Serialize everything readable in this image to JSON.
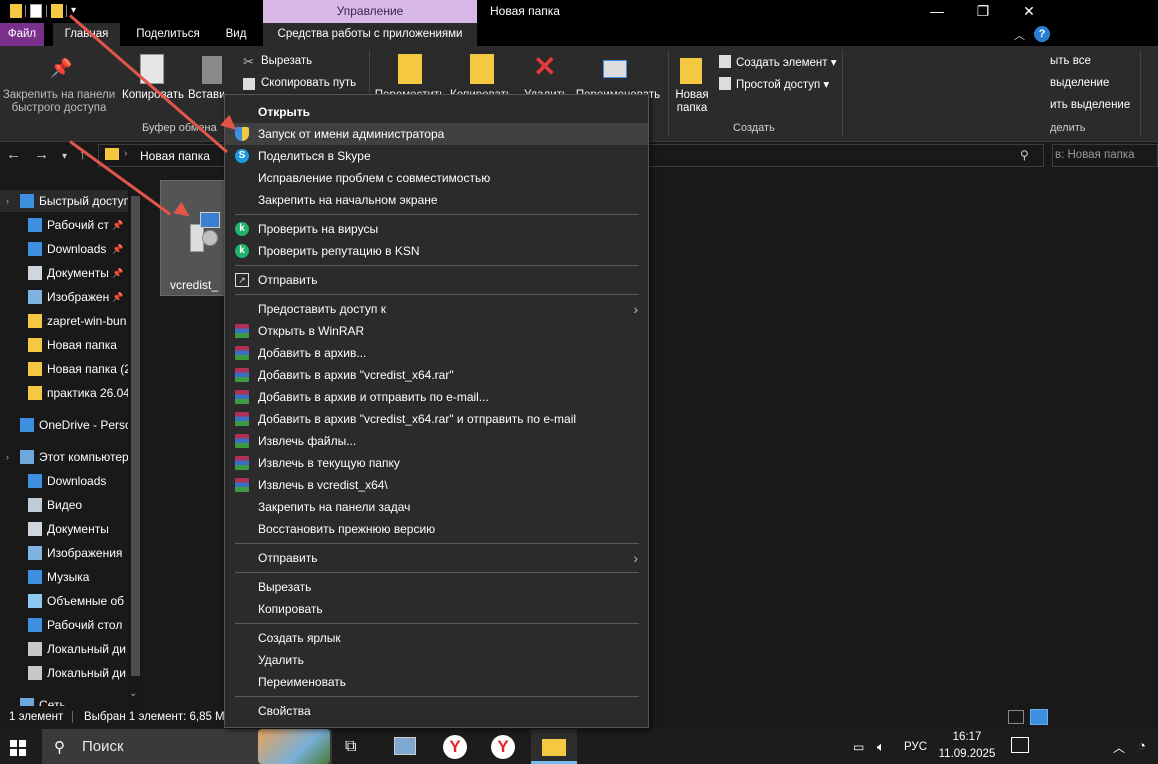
{
  "titlebar": {
    "manage_tab": "Управление",
    "window_title": "Новая папка",
    "minimize": "—",
    "maximize": "❐",
    "close": "✕"
  },
  "ribbon_tabs": {
    "file": "Файл",
    "home": "Главная",
    "share": "Поделиться",
    "view": "Вид",
    "app_tools": "Средства работы с приложениями"
  },
  "ribbon": {
    "pin_label": "Закрепить на панели быстрого доступа",
    "copy": "Копировать",
    "paste": "Вставить",
    "cut": "Вырезать",
    "copy_path": "Скопировать путь",
    "clipboard_group": "Буфер обмена",
    "move": "Переместить",
    "copy_to": "Копировать",
    "delete": "Удалить",
    "rename": "Переименовать",
    "new_folder_line1": "Новая",
    "new_folder_line2": "папка",
    "new_item": "Создать элемент ▾",
    "easy_access": "Простой доступ ▾",
    "create_group": "Создать",
    "select_all": "ыть все",
    "select_none": "выделение",
    "invert_selection": "ить выделение",
    "select_group": "делить"
  },
  "navbar": {
    "path": "Новая папка",
    "search_placeholder": "в: Новая папка"
  },
  "nav_pane": [
    {
      "label": "Быстрый доступ",
      "icon": "star-icon"
    },
    {
      "label": "Рабочий ст",
      "icon": "desktop-icon",
      "pinned": true
    },
    {
      "label": "Downloads",
      "icon": "download-icon",
      "pinned": true
    },
    {
      "label": "Документы",
      "icon": "documents-icon",
      "pinned": true
    },
    {
      "label": "Изображен",
      "icon": "pictures-icon",
      "pinned": true
    },
    {
      "label": "zapret-win-bun",
      "icon": "folder-icon"
    },
    {
      "label": "Новая папка",
      "icon": "folder-icon"
    },
    {
      "label": "Новая папка (2",
      "icon": "folder-icon"
    },
    {
      "label": "практика 26.04",
      "icon": "folder-icon"
    },
    {
      "label": "OneDrive - Perso",
      "icon": "onedrive-icon"
    },
    {
      "label": "Этот компьютер",
      "icon": "computer-icon"
    },
    {
      "label": "Downloads",
      "icon": "download-icon"
    },
    {
      "label": "Видео",
      "icon": "video-icon"
    },
    {
      "label": "Документы",
      "icon": "documents-icon"
    },
    {
      "label": "Изображения",
      "icon": "pictures-icon"
    },
    {
      "label": "Музыка",
      "icon": "music-icon"
    },
    {
      "label": "Объемные об",
      "icon": "3d-objects-icon"
    },
    {
      "label": "Рабочий стол",
      "icon": "desktop-icon"
    },
    {
      "label": "Локальный ди",
      "icon": "drive-icon"
    },
    {
      "label": "Локальный ди",
      "icon": "drive-icon"
    },
    {
      "label": "Сеть",
      "icon": "network-icon"
    }
  ],
  "file": {
    "name": "vcredist_"
  },
  "context_menu": [
    {
      "label": "Открыть",
      "bold": true,
      "icon": ""
    },
    {
      "label": "Запуск от имени администратора",
      "icon": "shield-icon",
      "highlighted": true
    },
    {
      "label": "Поделиться в Skype",
      "icon": "skype-icon"
    },
    {
      "label": "Исправление проблем с совместимостью",
      "icon": ""
    },
    {
      "label": "Закрепить на начальном экране",
      "icon": ""
    },
    {
      "sep": true
    },
    {
      "label": "Проверить на вирусы",
      "icon": "kaspersky-icon"
    },
    {
      "label": "Проверить репутацию в KSN",
      "icon": "kaspersky-icon"
    },
    {
      "sep": true
    },
    {
      "label": "Отправить",
      "icon": "share-icon"
    },
    {
      "sep": true
    },
    {
      "label": "Предоставить доступ к",
      "icon": "",
      "submenu": true
    },
    {
      "label": "Открыть в WinRAR",
      "icon": "winrar-icon"
    },
    {
      "label": "Добавить в архив...",
      "icon": "winrar-icon"
    },
    {
      "label": "Добавить в архив \"vcredist_x64.rar\"",
      "icon": "winrar-icon"
    },
    {
      "label": "Добавить в архив и отправить по e-mail...",
      "icon": "winrar-icon"
    },
    {
      "label": "Добавить в архив \"vcredist_x64.rar\" и отправить по e-mail",
      "icon": "winrar-icon"
    },
    {
      "label": "Извлечь файлы...",
      "icon": "winrar-icon"
    },
    {
      "label": "Извлечь в текущую папку",
      "icon": "winrar-icon"
    },
    {
      "label": "Извлечь в vcredist_x64\\",
      "icon": "winrar-icon"
    },
    {
      "label": "Закрепить на панели задач",
      "icon": ""
    },
    {
      "label": "Восстановить прежнюю версию",
      "icon": ""
    },
    {
      "sep": true
    },
    {
      "label": "Отправить",
      "icon": "",
      "submenu": true
    },
    {
      "sep": true
    },
    {
      "label": "Вырезать",
      "icon": ""
    },
    {
      "label": "Копировать",
      "icon": ""
    },
    {
      "sep": true
    },
    {
      "label": "Создать ярлык",
      "icon": ""
    },
    {
      "label": "Удалить",
      "icon": ""
    },
    {
      "label": "Переименовать",
      "icon": ""
    },
    {
      "sep": true
    },
    {
      "label": "Свойства",
      "icon": ""
    }
  ],
  "statusbar": {
    "count": "1 элемент",
    "selected": "Выбран 1 элемент: 6,85 М"
  },
  "taskbar": {
    "search_label": "Поиск",
    "language": "РУС",
    "time": "16:17",
    "date": "11.09.2025"
  },
  "colors": {
    "file_tab": "#7b2f8c",
    "manage_tab": "#d8b8e6",
    "arrow": "#e2564a",
    "menu_bg": "#2b2b2b",
    "highlight": "#404040"
  }
}
